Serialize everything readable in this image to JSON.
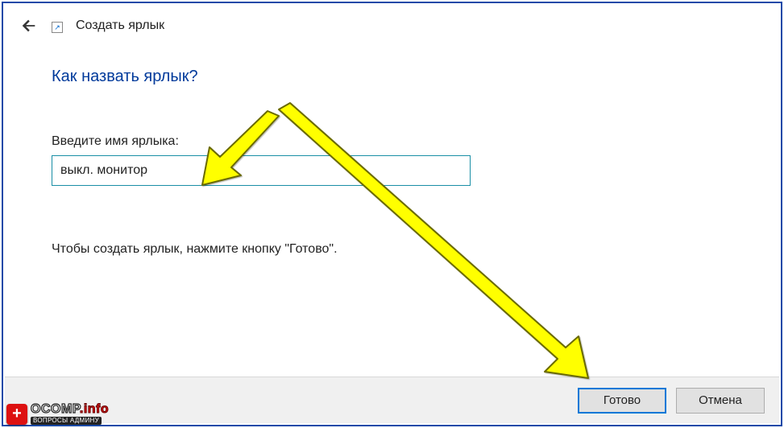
{
  "header": {
    "title": "Создать ярлык"
  },
  "content": {
    "heading": "Как назвать ярлык?",
    "field_label": "Введите имя ярлыка:",
    "input_value": "выкл. монитор",
    "hint": "Чтобы создать ярлык, нажмите кнопку \"Готово\"."
  },
  "footer": {
    "finish": "Готово",
    "cancel": "Отмена"
  },
  "watermark": {
    "brand": "OCOMP",
    "tld": ".info",
    "sub": "ВОПРОСЫ АДМИНУ"
  },
  "colors": {
    "frame_border": "#1a4aa8",
    "heading": "#003a9b",
    "input_border": "#1a8fa6",
    "primary_border": "#0078d7",
    "arrow_fill": "#ffff00",
    "arrow_stroke": "#5a5a00",
    "badge_red": "#dd1111"
  }
}
